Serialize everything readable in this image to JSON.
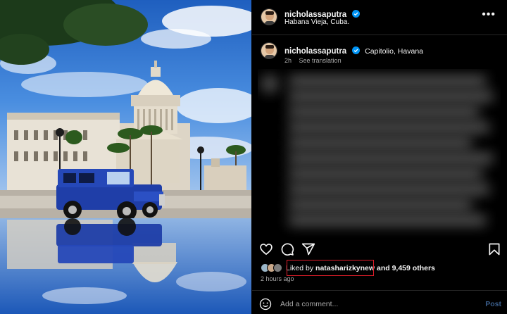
{
  "post": {
    "author": "nicholassaputra",
    "header_location": "Habana Vieja, Cuba.",
    "caption_location": "Capitolio, Havana",
    "posted_relative": "2h",
    "see_translation": "See translation"
  },
  "engagement": {
    "liked_by_prefix": "Liked by",
    "liked_by_user": "natasharizkynew",
    "and_others": "and 9,459 others",
    "time_ago": "2 hours ago"
  },
  "comment": {
    "placeholder": "Add a comment...",
    "post_label": "Post"
  },
  "colors": {
    "background": "#000000",
    "verified_badge": "#0095f6",
    "muted_text": "#a8a8a8",
    "highlight_border": "#e11d2a"
  },
  "icons": [
    "more-options-icon",
    "verified-icon",
    "heart-icon",
    "comment-icon",
    "share-icon",
    "bookmark-icon",
    "emoji-icon"
  ]
}
